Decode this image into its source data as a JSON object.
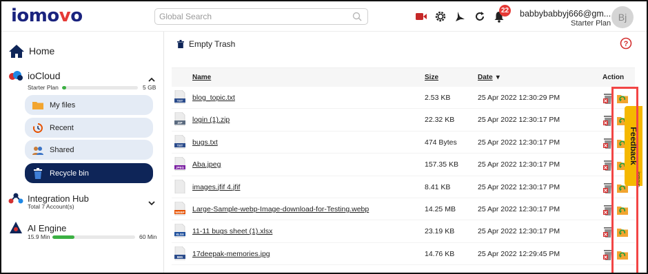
{
  "logo": {
    "text_main": "io",
    "text_mid": "mo",
    "text_v": "v",
    "text_end": "o"
  },
  "search": {
    "placeholder": "Global Search"
  },
  "topbar": {
    "icons": [
      "video-icon",
      "gear-icon",
      "moon-icon",
      "refresh-icon",
      "bell-icon"
    ],
    "notification_count": "22",
    "user_email": "babbybabbyj666@gm...",
    "user_plan": "Starter Plan",
    "avatar_initials": "Bj"
  },
  "sidebar": {
    "home_label": "Home",
    "iocloud": {
      "label": "ioCloud",
      "plan": "Starter Plan",
      "storage_fraction": 0.05,
      "capacity": "5 GB"
    },
    "nav": [
      {
        "label": "My files",
        "icon": "folder-icon",
        "active": false
      },
      {
        "label": "Recent",
        "icon": "recent-icon",
        "active": false
      },
      {
        "label": "Shared",
        "icon": "shared-icon",
        "active": false
      },
      {
        "label": "Recycle bin",
        "icon": "recycle-bin-icon",
        "active": true
      }
    ],
    "integration": {
      "label": "Integration Hub",
      "sub": "Total 7 Account(s)"
    },
    "ai": {
      "label": "AI Engine",
      "used": "15.9 Min",
      "fraction": 0.27,
      "total": "60 Min"
    }
  },
  "main": {
    "empty_trash_label": "Empty Trash",
    "columns": {
      "name": "Name",
      "size": "Size",
      "date": "Date",
      "action": "Action"
    },
    "files": [
      {
        "name": "blog_topic.txt",
        "size": "2.53 KB",
        "date": "25 Apr 2022 12:30:29 PM",
        "type": "TXT"
      },
      {
        "name": "login (1).zip",
        "size": "22.32 KB",
        "date": "25 Apr 2022 12:30:17 PM",
        "type": "ZIP"
      },
      {
        "name": "bugs.txt",
        "size": "474 Bytes",
        "date": "25 Apr 2022 12:30:17 PM",
        "type": "TXT"
      },
      {
        "name": "Aba.jpeg",
        "size": "157.35 KB",
        "date": "25 Apr 2022 12:30:17 PM",
        "type": "JPEG"
      },
      {
        "name": "images.jfif 4.jfif",
        "size": "8.41 KB",
        "date": "25 Apr 2022 12:30:17 PM",
        "type": ""
      },
      {
        "name": "Large-Sample-webp-Image-download-for-Testing.webp",
        "size": "14.25 MB",
        "date": "25 Apr 2022 12:30:17 PM",
        "type": "WEBP"
      },
      {
        "name": "11-11 bugs sheet (1).xlsx",
        "size": "23.19 KB",
        "date": "25 Apr 2022 12:30:17 PM",
        "type": "XLSX"
      },
      {
        "name": "17deepak-memories.jpg",
        "size": "14.76 KB",
        "date": "25 Apr 2022 12:29:45 PM",
        "type": "IMG"
      }
    ]
  },
  "feedback": {
    "label": "Feedback",
    "brand": "iomovo"
  },
  "colors": {
    "brand_navy": "#0e2558",
    "accent_red": "#e53935",
    "progress_green": "#3cb043",
    "feedback_yellow": "#f5b800",
    "highlight_red": "#f24545"
  }
}
